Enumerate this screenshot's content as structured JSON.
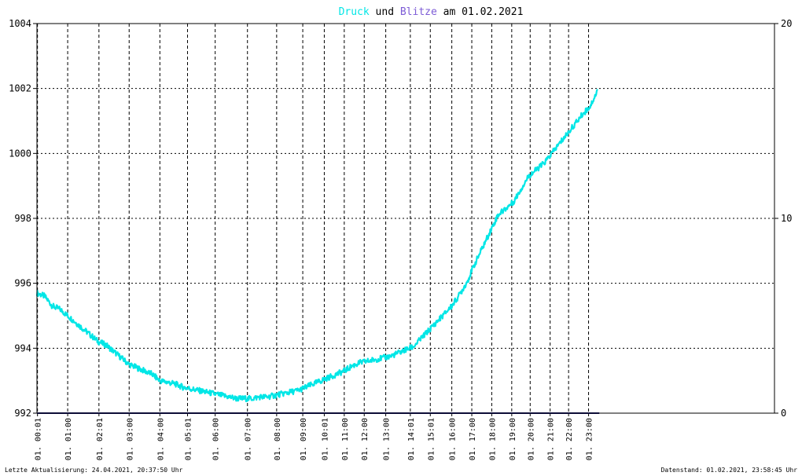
{
  "title": {
    "part1": "Druck",
    "part2": " und ",
    "part3": "Blitze",
    "part4": " am 01.02.2021",
    "colors": {
      "druck": "#00e6e6",
      "blitze": "#7d5cd6",
      "text": "#000000"
    }
  },
  "footer": {
    "left": "Letzte Aktualisierung: 24.04.2021, 20:37:50 Uhr",
    "right": "Datenstand: 01.02.2021, 23:58:45 Uhr"
  },
  "chart_data": {
    "type": "line",
    "title": "Druck und Blitze am 01.02.2021",
    "xlim": [
      0,
      24
    ],
    "ylim_left": [
      992,
      1004
    ],
    "ylim_right": [
      0,
      20
    ],
    "y_ticks_left": [
      992,
      994,
      996,
      998,
      1000,
      1002,
      1004
    ],
    "y_ticks_right": [
      0,
      10,
      20
    ],
    "x_ticks": [
      {
        "label": "01. 00:01",
        "x": 0.017
      },
      {
        "label": "01. 01:00",
        "x": 1.0
      },
      {
        "label": "01. 02:01",
        "x": 2.017
      },
      {
        "label": "01. 03:00",
        "x": 3.0
      },
      {
        "label": "01. 04:00",
        "x": 4.0
      },
      {
        "label": "01. 05:01",
        "x": 4.9
      },
      {
        "label": "01. 06:00",
        "x": 5.8
      },
      {
        "label": "01. 07:00",
        "x": 6.85
      },
      {
        "label": "01. 08:00",
        "x": 7.8
      },
      {
        "label": "01. 09:00",
        "x": 8.65
      },
      {
        "label": "01. 10:01",
        "x": 9.35
      },
      {
        "label": "01. 11:00",
        "x": 10.0
      },
      {
        "label": "01. 12:00",
        "x": 10.65
      },
      {
        "label": "01. 13:00",
        "x": 11.35
      },
      {
        "label": "01. 14:01",
        "x": 12.15
      },
      {
        "label": "01. 15:01",
        "x": 12.8
      },
      {
        "label": "01. 16:00",
        "x": 13.5
      },
      {
        "label": "01. 17:00",
        "x": 14.15
      },
      {
        "label": "01. 18:00",
        "x": 14.8
      },
      {
        "label": "01. 19:00",
        "x": 15.45
      },
      {
        "label": "01. 20:00",
        "x": 16.05
      },
      {
        "label": "01. 21:00",
        "x": 16.7
      },
      {
        "label": "01. 22:00",
        "x": 17.3
      },
      {
        "label": "01. 23:00",
        "x": 17.95
      }
    ],
    "grid": true,
    "series": [
      {
        "name": "Druck",
        "axis": "left",
        "color": "#00e6e6",
        "x": [
          0,
          0.25,
          0.5,
          0.75,
          1.0,
          1.25,
          1.5,
          1.75,
          2.0,
          2.25,
          2.5,
          2.75,
          3.0,
          3.25,
          3.5,
          3.75,
          4.0,
          4.25,
          4.5,
          4.75,
          5.0,
          5.25,
          5.5,
          5.75,
          6.0,
          6.25,
          6.5,
          6.75,
          7.0,
          7.25,
          7.5,
          7.75,
          8.0,
          8.25,
          8.5,
          8.75,
          9.0,
          9.25,
          9.5,
          9.75,
          10.0,
          10.25,
          10.5,
          10.75,
          11.0,
          11.25,
          11.5,
          11.75,
          12.0,
          12.25,
          12.5,
          12.75,
          13.0,
          13.25,
          13.5,
          13.75,
          14.0,
          14.25,
          14.5,
          14.75,
          15.0,
          15.25,
          15.5,
          15.75,
          16.0,
          16.25,
          16.5,
          16.75,
          17.0,
          17.25,
          17.5,
          17.75,
          18.0,
          18.25
        ],
        "values": [
          995.7,
          995.6,
          995.3,
          995.2,
          995.0,
          994.8,
          994.6,
          994.4,
          994.2,
          994.1,
          993.9,
          993.7,
          993.5,
          993.4,
          993.3,
          993.2,
          993.0,
          992.95,
          992.9,
          992.8,
          992.75,
          992.7,
          992.65,
          992.6,
          992.55,
          992.5,
          992.45,
          992.45,
          992.45,
          992.5,
          992.5,
          992.55,
          992.6,
          992.65,
          992.7,
          992.8,
          992.9,
          993.0,
          993.1,
          993.2,
          993.3,
          993.45,
          993.55,
          993.6,
          993.65,
          993.7,
          993.75,
          993.85,
          993.95,
          994.05,
          994.3,
          994.55,
          994.8,
          995.05,
          995.3,
          995.65,
          996.05,
          996.6,
          997.1,
          997.6,
          998.1,
          998.3,
          998.5,
          998.9,
          999.3,
          999.5,
          999.7,
          1000.0,
          1000.3,
          1000.6,
          1000.9,
          1001.2,
          1001.45,
          1001.95
        ]
      },
      {
        "name": "Blitze",
        "axis": "right",
        "color": "#1a1a6e",
        "x": [
          0,
          18.3
        ],
        "values": [
          0,
          0
        ]
      }
    ]
  }
}
